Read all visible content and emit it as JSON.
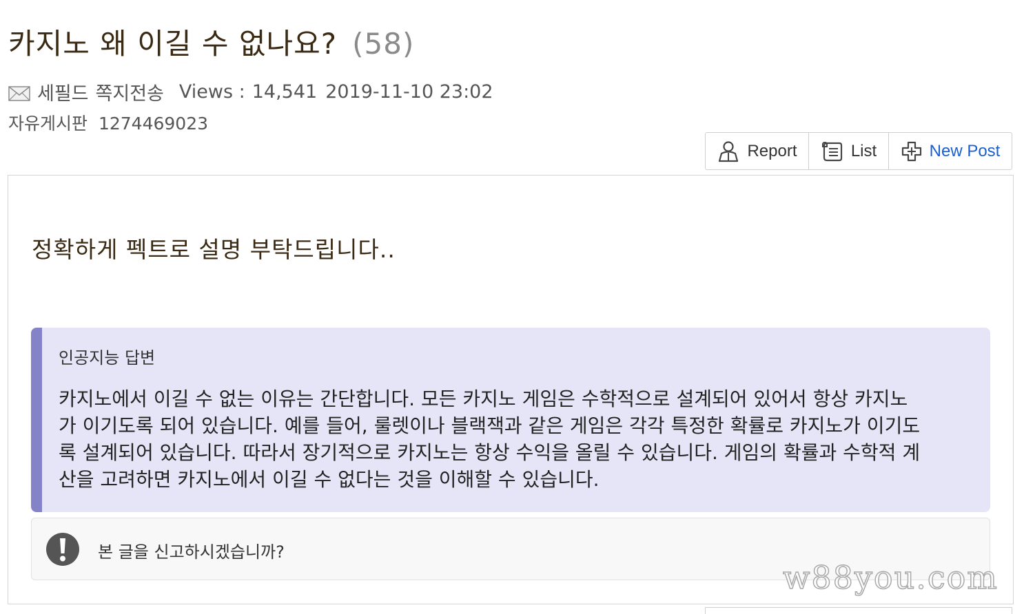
{
  "post": {
    "title": "카지노 왜 이길 수 없나요?",
    "comment_count": "(58)",
    "author": "세필드",
    "message_link": "쪽지전송",
    "views_label": "Views :",
    "views_value": "14,541",
    "datetime": "2019-11-10 23:02",
    "board": "자유게시판",
    "post_id": "1274469023",
    "body": "정확하게 펙트로 설명 부탁드립니다.."
  },
  "toolbar": {
    "report_label": "Report",
    "list_label": "List",
    "new_post_label": "New Post"
  },
  "ai_answer": {
    "title": "인공지능 답변",
    "lines": [
      "카지노에서 이길 수 없는 이유는 간단합니다. 모든 카지노 게임은 수학적으로 설계되어 있어서 항상 카지노",
      "가 이기도록 되어 있습니다. 예를 들어, 룰렛이나 블랙잭과 같은 게임은 각각 특정한 확률로 카지노가 이기도",
      "록 설계되어 있습니다. 따라서 장기적으로 카지노는 항상 수익을 올릴 수 있습니다. 게임의 확률과 수학적 계",
      "산을 고려하면 카지노에서 이길 수 없다는 것을 이해할 수 있습니다."
    ]
  },
  "report_prompt": "본 글을 신고하시겠습니까?",
  "watermark": "w88you.com",
  "icons": {
    "mail": "envelope-icon",
    "report": "person-icon",
    "list": "scroll-list-icon",
    "new_post": "plus-icon",
    "alert": "exclamation-icon"
  },
  "colors": {
    "title": "#3a2a14",
    "new_post_link": "#1a5fd0",
    "ai_box_bg": "#e6e5f7",
    "ai_box_accent": "#8583c7"
  }
}
